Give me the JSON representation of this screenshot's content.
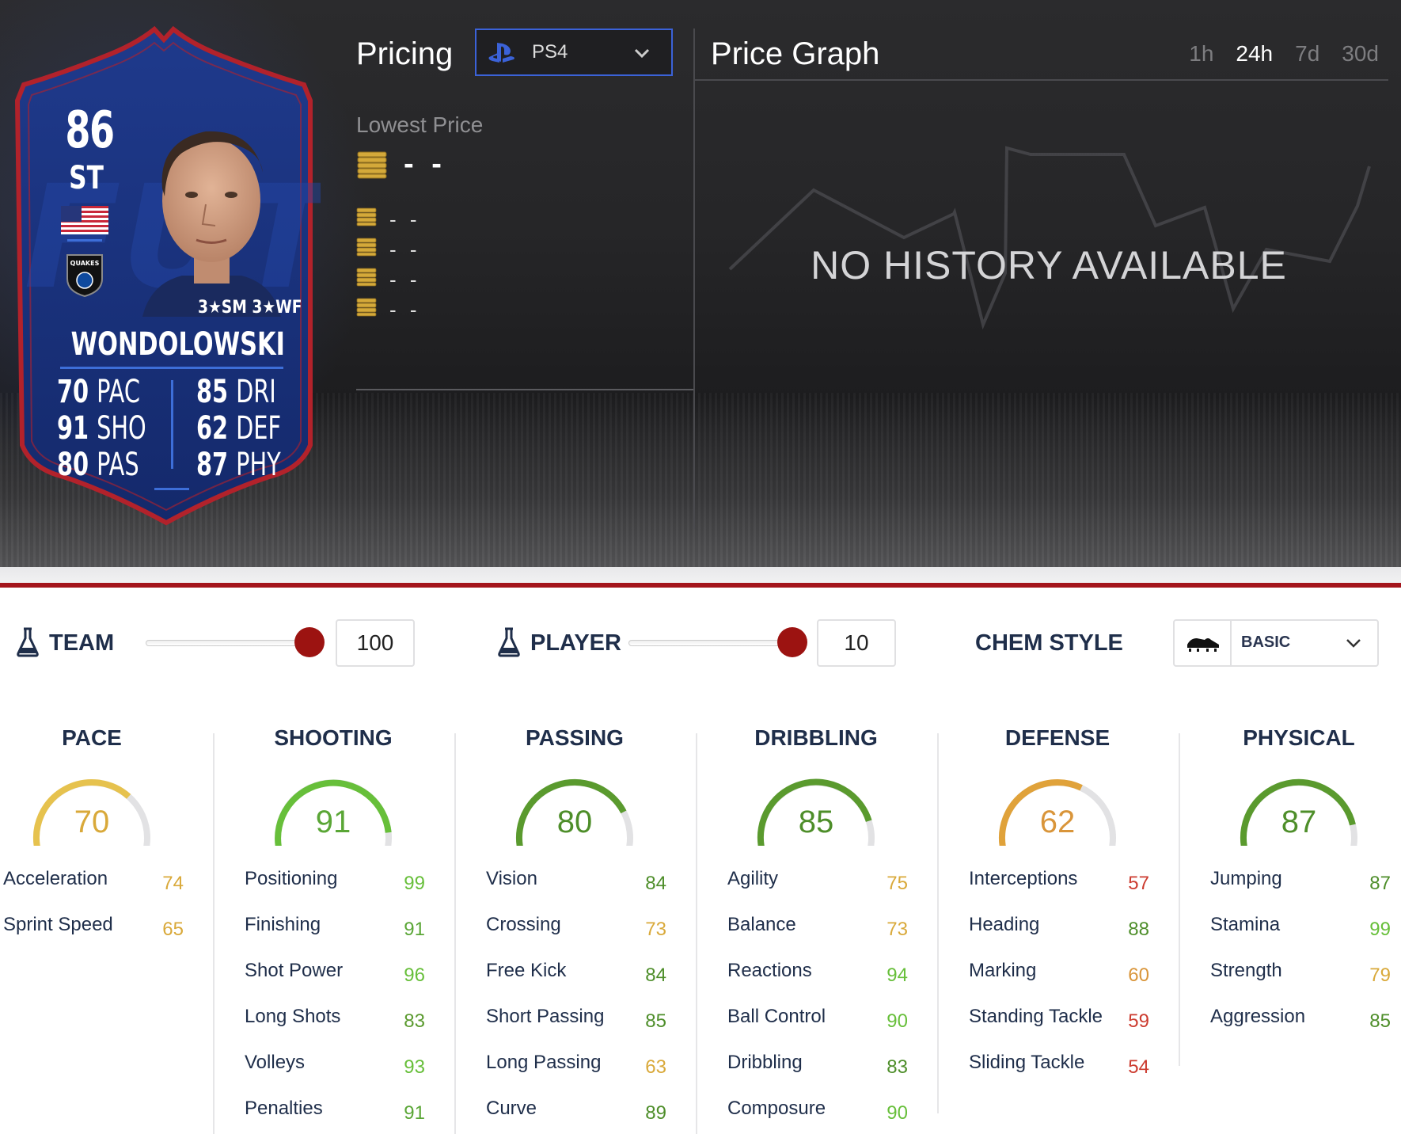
{
  "card": {
    "rating": "86",
    "position": "ST",
    "skills": "3★SM 3★WF",
    "name": "WONDOLOWSKI",
    "club_badge_text": "QUAKES",
    "stats": [
      {
        "value": "70",
        "label": "PAC"
      },
      {
        "value": "91",
        "label": "SHO"
      },
      {
        "value": "80",
        "label": "PAS"
      },
      {
        "value": "85",
        "label": "DRI"
      },
      {
        "value": "62",
        "label": "DEF"
      },
      {
        "value": "87",
        "label": "PHY"
      }
    ],
    "colors": {
      "shield": "#1e3580",
      "border": "#b2222b"
    }
  },
  "pricing": {
    "title": "Pricing",
    "platform": "PS4",
    "lowest_label": "Lowest Price",
    "lowest_value": "- -",
    "other_prices": [
      "- -",
      "- -",
      "- -",
      "- -"
    ]
  },
  "price_graph": {
    "title": "Price Graph",
    "ranges": [
      "1h",
      "24h",
      "7d",
      "30d"
    ],
    "active_range": "24h",
    "empty_message": "NO HISTORY AVAILABLE"
  },
  "controls": {
    "team_label": "TEAM",
    "team_value": "100",
    "team_fraction": 1.0,
    "player_label": "PLAYER",
    "player_value": "10",
    "player_fraction": 1.0,
    "chem_label": "CHEM STYLE",
    "chem_value": "BASIC"
  },
  "colors": {
    "green": "#5a9a2e",
    "bright_green": "#67bf3a",
    "yellow": "#e6c24e",
    "orange": "#e0a23a",
    "red": "#cc3b2f",
    "accent_red": "#a4151c",
    "gauge_bg": "#e2e2e4"
  },
  "categories": [
    {
      "name": "PACE",
      "value": "70",
      "color": "#e6c24e",
      "text_color": "#d9a93a",
      "stats": [
        {
          "label": "Acceleration",
          "value": "74",
          "color": "#d9a93a"
        },
        {
          "label": "Sprint Speed",
          "value": "65",
          "color": "#d9a93a"
        }
      ]
    },
    {
      "name": "SHOOTING",
      "value": "91",
      "color": "#67bf3a",
      "text_color": "#5aa636",
      "stats": [
        {
          "label": "Positioning",
          "value": "99",
          "color": "#67bf3a"
        },
        {
          "label": "Finishing",
          "value": "91",
          "color": "#5aa636"
        },
        {
          "label": "Shot Power",
          "value": "96",
          "color": "#67bf3a"
        },
        {
          "label": "Long Shots",
          "value": "83",
          "color": "#5a9a2e"
        },
        {
          "label": "Volleys",
          "value": "93",
          "color": "#67bf3a"
        },
        {
          "label": "Penalties",
          "value": "91",
          "color": "#5aa636"
        }
      ]
    },
    {
      "name": "PASSING",
      "value": "80",
      "color": "#5a9a2e",
      "text_color": "#4e8e2a",
      "stats": [
        {
          "label": "Vision",
          "value": "84",
          "color": "#4e8e2a"
        },
        {
          "label": "Crossing",
          "value": "73",
          "color": "#d9a93a"
        },
        {
          "label": "Free Kick",
          "value": "84",
          "color": "#4e8e2a"
        },
        {
          "label": "Short Passing",
          "value": "85",
          "color": "#4e8e2a"
        },
        {
          "label": "Long Passing",
          "value": "63",
          "color": "#d9a93a"
        },
        {
          "label": "Curve",
          "value": "89",
          "color": "#4e8e2a"
        }
      ]
    },
    {
      "name": "DRIBBLING",
      "value": "85",
      "color": "#5a9a2e",
      "text_color": "#4e8e2a",
      "stats": [
        {
          "label": "Agility",
          "value": "75",
          "color": "#d9a93a"
        },
        {
          "label": "Balance",
          "value": "73",
          "color": "#d9a93a"
        },
        {
          "label": "Reactions",
          "value": "94",
          "color": "#67bf3a"
        },
        {
          "label": "Ball Control",
          "value": "90",
          "color": "#67bf3a"
        },
        {
          "label": "Dribbling",
          "value": "83",
          "color": "#4e8e2a"
        },
        {
          "label": "Composure",
          "value": "90",
          "color": "#67bf3a"
        }
      ]
    },
    {
      "name": "DEFENSE",
      "value": "62",
      "color": "#e0a23a",
      "text_color": "#d9953a",
      "stats": [
        {
          "label": "Interceptions",
          "value": "57",
          "color": "#cc3b2f"
        },
        {
          "label": "Heading",
          "value": "88",
          "color": "#4e8e2a"
        },
        {
          "label": "Marking",
          "value": "60",
          "color": "#d9953a"
        },
        {
          "label": "Standing Tackle",
          "value": "59",
          "color": "#cc3b2f"
        },
        {
          "label": "Sliding Tackle",
          "value": "54",
          "color": "#cc3b2f"
        }
      ]
    },
    {
      "name": "PHYSICAL",
      "value": "87",
      "color": "#5a9a2e",
      "text_color": "#4e8e2a",
      "stats": [
        {
          "label": "Jumping",
          "value": "87",
          "color": "#4e8e2a"
        },
        {
          "label": "Stamina",
          "value": "99",
          "color": "#67bf3a"
        },
        {
          "label": "Strength",
          "value": "79",
          "color": "#d9a93a"
        },
        {
          "label": "Aggression",
          "value": "85",
          "color": "#4e8e2a"
        }
      ]
    }
  ]
}
